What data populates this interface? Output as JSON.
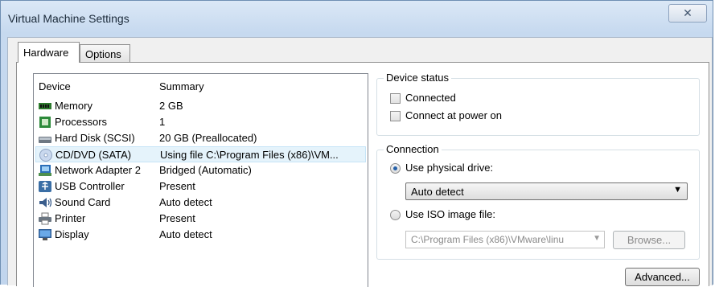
{
  "window": {
    "title": "Virtual Machine Settings",
    "close_glyph": "✕"
  },
  "tabs": [
    {
      "label": "Hardware"
    },
    {
      "label": "Options"
    }
  ],
  "device_table": {
    "headers": {
      "device": "Device",
      "summary": "Summary"
    },
    "rows": [
      {
        "name": "Memory",
        "summary": "2 GB",
        "icon": "memory-icon"
      },
      {
        "name": "Processors",
        "summary": "1",
        "icon": "processor-icon"
      },
      {
        "name": "Hard Disk (SCSI)",
        "summary": "20 GB (Preallocated)",
        "icon": "hard-disk-icon"
      },
      {
        "name": "CD/DVD (SATA)",
        "summary": "Using file C:\\Program Files (x86)\\VM...",
        "icon": "cd-dvd-icon"
      },
      {
        "name": "Network Adapter 2",
        "summary": "Bridged (Automatic)",
        "icon": "network-adapter-icon"
      },
      {
        "name": "USB Controller",
        "summary": "Present",
        "icon": "usb-icon"
      },
      {
        "name": "Sound Card",
        "summary": "Auto detect",
        "icon": "sound-card-icon"
      },
      {
        "name": "Printer",
        "summary": "Present",
        "icon": "printer-icon"
      },
      {
        "name": "Display",
        "summary": "Auto detect",
        "icon": "display-icon"
      }
    ]
  },
  "device_status": {
    "label": "Device status",
    "connected_label": "Connected",
    "connect_at_power_on_label": "Connect at power on"
  },
  "connection": {
    "label": "Connection",
    "use_physical_drive_label": "Use physical drive:",
    "physical_drive_value": "Auto detect",
    "use_iso_label": "Use ISO image file:",
    "iso_path_value": "C:\\Program Files (x86)\\VMware\\linu",
    "browse_label": "Browse..."
  },
  "advanced_label": "Advanced..."
}
